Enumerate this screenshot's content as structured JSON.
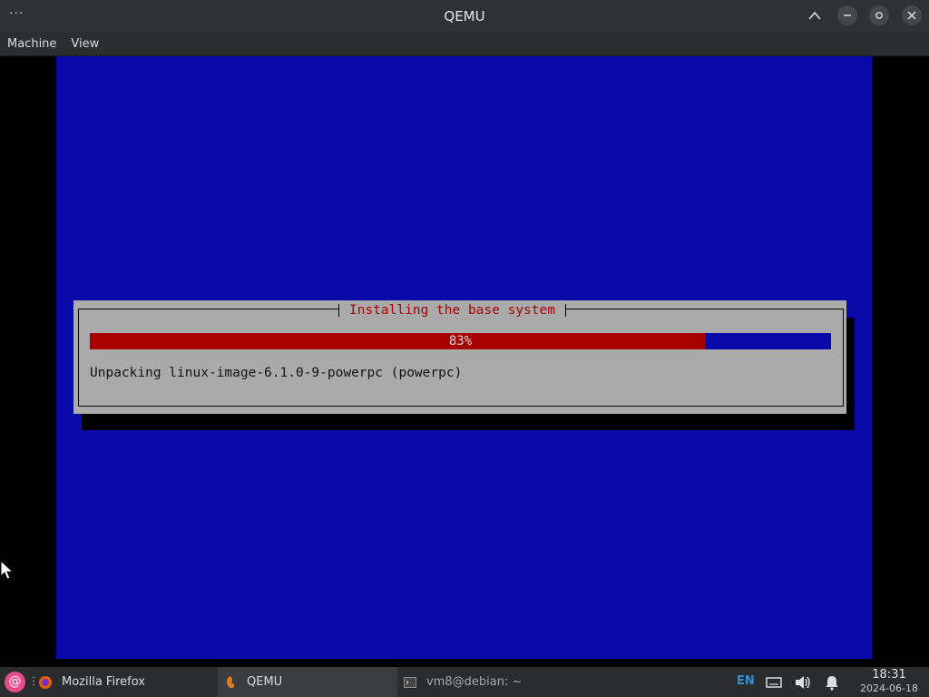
{
  "window": {
    "title": "QEMU",
    "menu": [
      "Machine",
      "View"
    ]
  },
  "installer": {
    "dialog_title": "Installing the base system",
    "progress_percent": 83,
    "progress_label": "83%",
    "status": "Unpacking linux-image-6.1.0-9-powerpc (powerpc)"
  },
  "taskbar": {
    "tasks": [
      {
        "label": "Mozilla Firefox",
        "icon": "firefox-icon"
      },
      {
        "label": "QEMU",
        "icon": "qemu-icon",
        "active": true
      },
      {
        "label": "vm8@debian: ~",
        "icon": "terminal-icon"
      }
    ],
    "keyboard_layout": "EN",
    "time": "18:31",
    "date": "2024-06-18"
  },
  "colors": {
    "guest_background": "#0a0aa8",
    "dialog_background": "#aaaaaa",
    "accent_red": "#a80000"
  }
}
